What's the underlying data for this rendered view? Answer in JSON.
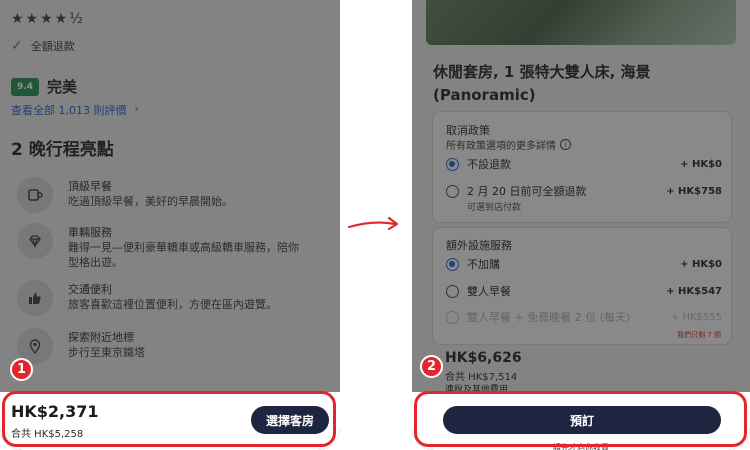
{
  "left": {
    "stars": "★★★★½",
    "refund": "全額退款",
    "score": "9.4",
    "rating_word": "完美",
    "reviews_link": "查看全部 1,013 則評價",
    "reviews_chevron": "›",
    "section_title": "2 晚行程亮點",
    "highlights": [
      {
        "icon": "cup-icon",
        "title": "頂級早餐",
        "desc": "吃過頂級早餐，美好的早晨開始。"
      },
      {
        "icon": "diamond-icon",
        "title": "車輛服務",
        "desc": "難得一見—便利豪華轎車或高級轎車服務，陪你型格出遊。"
      },
      {
        "icon": "thumbs-up-icon",
        "title": "交通便利",
        "desc": "旅客喜歡這裡位置便利，方便在區內遊覽。"
      },
      {
        "icon": "map-pin-icon",
        "title": "探索附近地標",
        "desc": "步行至東京鐵塔"
      }
    ],
    "price": "HK$2,371",
    "total": "合共 HK$5,258",
    "select_button": "選擇客房",
    "badge": "1"
  },
  "right": {
    "room_title": "休閒套房, 1 張特大雙人床, 海景 (Panoramic)",
    "cancel_heading": "取消政策",
    "cancel_sub": "所有政策選項的更多詳情",
    "cancel_options": [
      {
        "label": "不設退款",
        "price": "+ HK$0",
        "selected": true
      },
      {
        "label": "2 月 20 日前可全額退款",
        "price": "+ HK$758",
        "selected": false,
        "note": "可選到店付款"
      }
    ],
    "extras_heading": "額外設施服務",
    "extras_options": [
      {
        "label": "不加購",
        "price": "+ HK$0",
        "selected": true
      },
      {
        "label": "雙人早餐",
        "price": "+ HK$547",
        "selected": false
      },
      {
        "label": "雙人早餐 + 免費晚餐 2 位 (每天)",
        "price": "+ HK$555",
        "selected": false,
        "disabled": true
      }
    ],
    "limit_note": "我們只剩 7 間",
    "price": "HK$6,626",
    "total": "合共 HK$7,514",
    "tax_note": "連稅及其他費用",
    "book_button": "預訂",
    "book_note": "請先才向你收費",
    "badge": "2"
  },
  "colors": {
    "accent_red": "#e3262b",
    "button_navy": "#1e2540",
    "link_blue": "#1a58c9",
    "score_green": "#1b8a45"
  }
}
